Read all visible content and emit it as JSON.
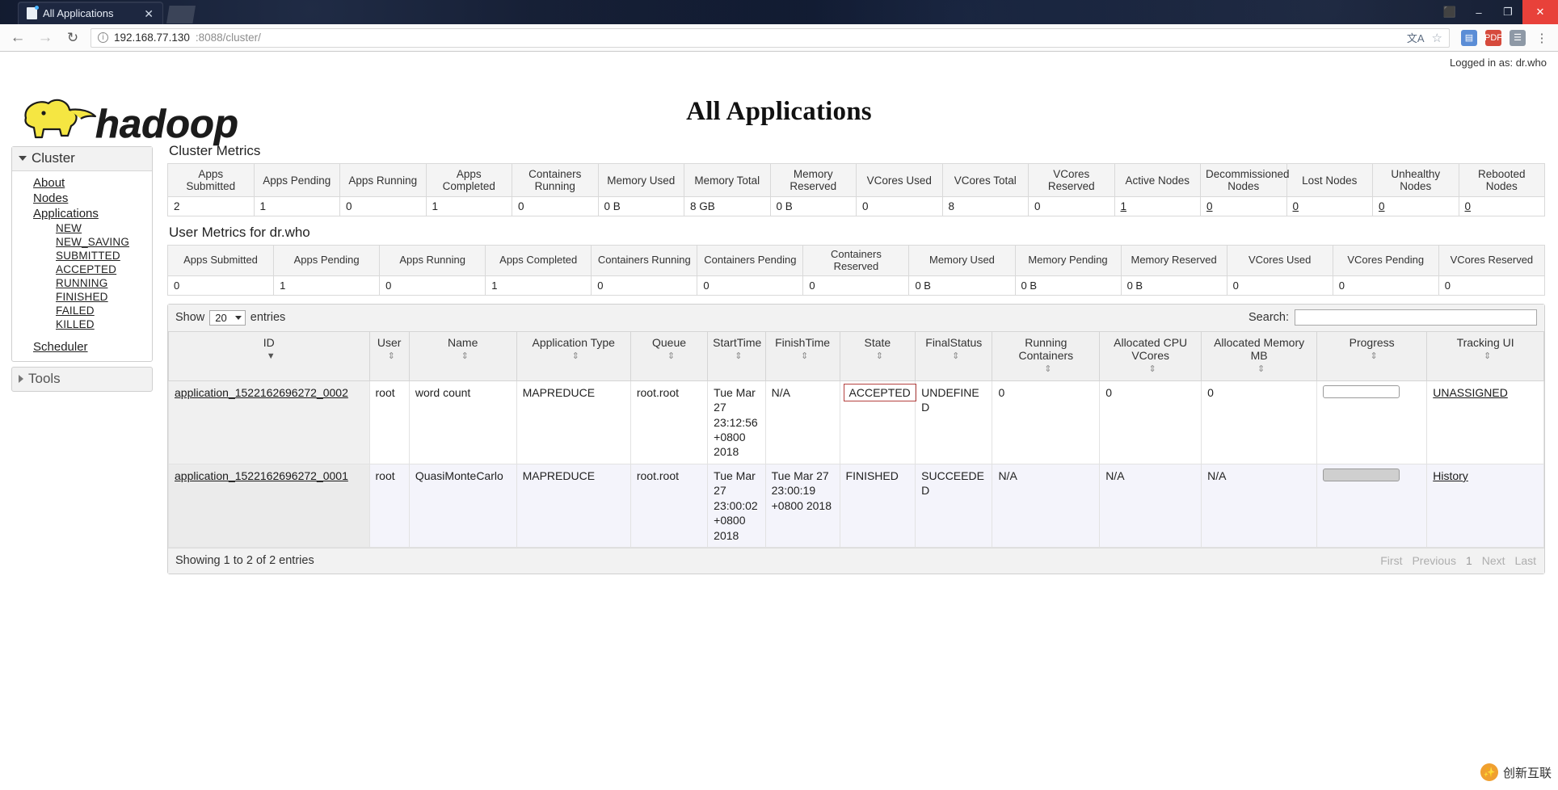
{
  "browser": {
    "tab_title": "All Applications",
    "tab_close_label": "✕",
    "back_icon": "←",
    "forward_icon": "→",
    "reload_icon": "↻",
    "info_icon": "ⓘ",
    "url_host": "192.168.77.130",
    "url_rest": ":8088/cluster/",
    "translate_icon": "文A",
    "star_icon": "☆",
    "ext1_label": "▤",
    "ext2_label": "PDF",
    "ext3_label": "☰",
    "menu_icon": "⋮",
    "win_minimize": "–",
    "win_restore": "❐",
    "win_close": "✕",
    "win_extra": "⬛"
  },
  "page": {
    "logged_in": "Logged in as: dr.who",
    "title": "All Applications",
    "logo_text": "hadoop"
  },
  "sidebar": {
    "cluster_header": "Cluster",
    "links": [
      {
        "label": "About",
        "level": 1
      },
      {
        "label": "Nodes",
        "level": 1
      },
      {
        "label": "Applications",
        "level": 1
      },
      {
        "label": "NEW",
        "level": 2
      },
      {
        "label": "NEW_SAVING",
        "level": 2
      },
      {
        "label": "SUBMITTED",
        "level": 2
      },
      {
        "label": "ACCEPTED",
        "level": 2
      },
      {
        "label": "RUNNING",
        "level": 2
      },
      {
        "label": "FINISHED",
        "level": 2
      },
      {
        "label": "FAILED",
        "level": 2
      },
      {
        "label": "KILLED",
        "level": 2
      }
    ],
    "scheduler_label": "Scheduler",
    "tools_header": "Tools"
  },
  "cluster_metrics": {
    "title": "Cluster Metrics",
    "headers": [
      "Apps Submitted",
      "Apps Pending",
      "Apps Running",
      "Apps Completed",
      "Containers Running",
      "Memory Used",
      "Memory Total",
      "Memory Reserved",
      "VCores Used",
      "VCores Total",
      "VCores Reserved",
      "Active Nodes",
      "Decommissioned Nodes",
      "Lost Nodes",
      "Unhealthy Nodes",
      "Rebooted Nodes"
    ],
    "values": [
      "2",
      "1",
      "0",
      "1",
      "0",
      "0 B",
      "8 GB",
      "0 B",
      "0",
      "8",
      "0",
      "1",
      "0",
      "0",
      "0",
      "0"
    ],
    "linked": [
      false,
      false,
      false,
      false,
      false,
      false,
      false,
      false,
      false,
      false,
      false,
      true,
      true,
      true,
      true,
      true
    ]
  },
  "user_metrics": {
    "title": "User Metrics for dr.who",
    "headers": [
      "Apps Submitted",
      "Apps Pending",
      "Apps Running",
      "Apps Completed",
      "Containers Running",
      "Containers Pending",
      "Containers Reserved",
      "Memory Used",
      "Memory Pending",
      "Memory Reserved",
      "VCores Used",
      "VCores Pending",
      "VCores Reserved"
    ],
    "values": [
      "0",
      "1",
      "0",
      "1",
      "0",
      "0",
      "0",
      "0 B",
      "0 B",
      "0 B",
      "0",
      "0",
      "0"
    ]
  },
  "datatable": {
    "show_label": "Show",
    "page_length": "20",
    "entries_label": "entries",
    "search_label": "Search:",
    "search_value": "",
    "search_placeholder": "",
    "columns": [
      {
        "label": "ID",
        "sort": "down"
      },
      {
        "label": "User",
        "sort": "both"
      },
      {
        "label": "Name",
        "sort": "both"
      },
      {
        "label": "Application Type",
        "sort": "both"
      },
      {
        "label": "Queue",
        "sort": "both"
      },
      {
        "label": "StartTime",
        "sort": "both"
      },
      {
        "label": "FinishTime",
        "sort": "both"
      },
      {
        "label": "State",
        "sort": "both"
      },
      {
        "label": "FinalStatus",
        "sort": "both"
      },
      {
        "label": "Running Containers",
        "sort": "both"
      },
      {
        "label": "Allocated CPU VCores",
        "sort": "both"
      },
      {
        "label": "Allocated Memory MB",
        "sort": "both"
      },
      {
        "label": "Progress",
        "sort": "both"
      },
      {
        "label": "Tracking UI",
        "sort": "both"
      }
    ],
    "rows": [
      {
        "id": "application_1522162696272_0002",
        "user": "root",
        "name": "word count",
        "app_type": "MAPREDUCE",
        "queue": "root.root",
        "start_time": "Tue Mar 27 23:12:56 +0800 2018",
        "finish_time": "N/A",
        "state": "ACCEPTED",
        "state_highlighted": true,
        "final_status": "UNDEFINED",
        "running_containers": "0",
        "allocated_cpu_vcores": "0",
        "allocated_memory_mb": "0",
        "progress": 0,
        "tracking_ui": "UNASSIGNED"
      },
      {
        "id": "application_1522162696272_0001",
        "user": "root",
        "name": "QuasiMonteCarlo",
        "app_type": "MAPREDUCE",
        "queue": "root.root",
        "start_time": "Tue Mar 27 23:00:02 +0800 2018",
        "finish_time": "Tue Mar 27 23:00:19 +0800 2018",
        "state": "FINISHED",
        "state_highlighted": false,
        "final_status": "SUCCEEDED",
        "running_containers": "N/A",
        "allocated_cpu_vcores": "N/A",
        "allocated_memory_mb": "N/A",
        "progress": 100,
        "tracking_ui": "History"
      }
    ],
    "info_text": "Showing 1 to 2 of 2 entries",
    "paginate": [
      "First",
      "Previous",
      "1",
      "Next",
      "Last"
    ]
  },
  "watermark": {
    "text": "创新互联",
    "badge": "✨"
  },
  "colors": {
    "highlight_border": "#b4413f",
    "logo_yellow": "#f7e94b",
    "link": "#1a1a1a"
  }
}
